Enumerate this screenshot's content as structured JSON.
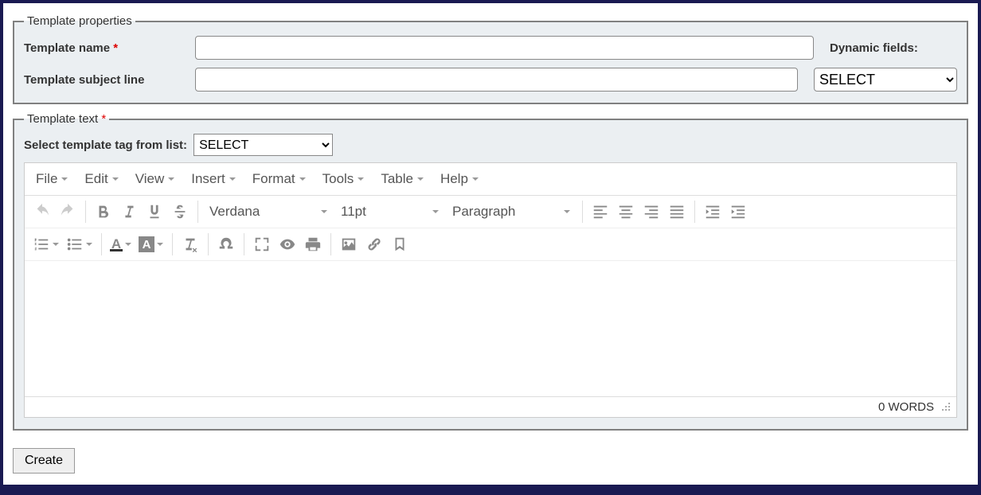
{
  "properties": {
    "legend": "Template properties",
    "name_label": "Template name",
    "name_value": "",
    "subject_label": "Template subject line",
    "subject_value": "",
    "dynamic_fields_label": "Dynamic fields:",
    "dynamic_fields_value": "SELECT"
  },
  "text_section": {
    "legend": "Template text",
    "tag_label": "Select template tag from list:",
    "tag_value": "SELECT"
  },
  "editor": {
    "menus": [
      "File",
      "Edit",
      "View",
      "Insert",
      "Format",
      "Tools",
      "Table",
      "Help"
    ],
    "font_family": "Verdana",
    "font_size": "11pt",
    "block_format": "Paragraph",
    "word_count_label": "0 WORDS"
  },
  "actions": {
    "create_label": "Create"
  }
}
